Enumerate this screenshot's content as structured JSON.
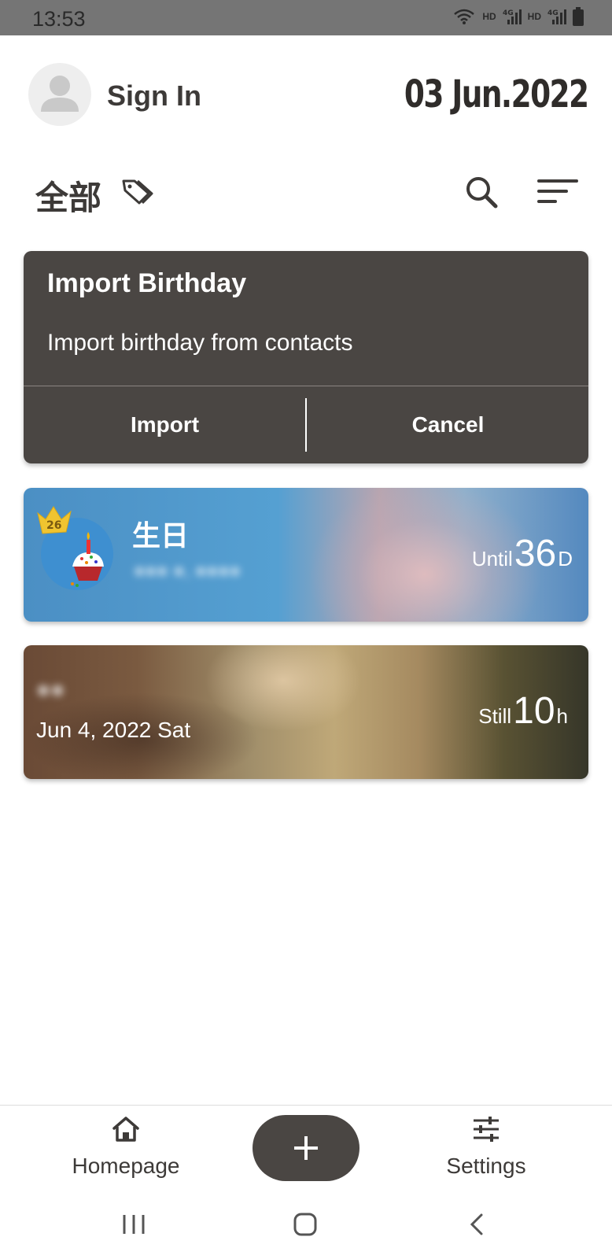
{
  "status_bar": {
    "time": "13:53",
    "network_1": "HD",
    "network_2": "HD"
  },
  "header": {
    "sign_in_label": "Sign In",
    "date": "03 Jun.2022"
  },
  "toolbar": {
    "category_label": "全部"
  },
  "import_dialog": {
    "title": "Import Birthday",
    "message": "Import birthday from contacts",
    "import_label": "Import",
    "cancel_label": "Cancel"
  },
  "events": [
    {
      "title": "生日",
      "badge_age": "26",
      "countdown_prefix": "Until",
      "countdown_value": "36",
      "countdown_unit": "D",
      "accent": "#4b8fc4"
    },
    {
      "date": "Jun 4, 2022 Sat",
      "countdown_prefix": "Still",
      "countdown_value": "10",
      "countdown_unit": "h"
    }
  ],
  "bottom_nav": {
    "home_label": "Homepage",
    "settings_label": "Settings"
  },
  "colors": {
    "dark_surface": "#4a4643",
    "status_bar": "#757575"
  }
}
